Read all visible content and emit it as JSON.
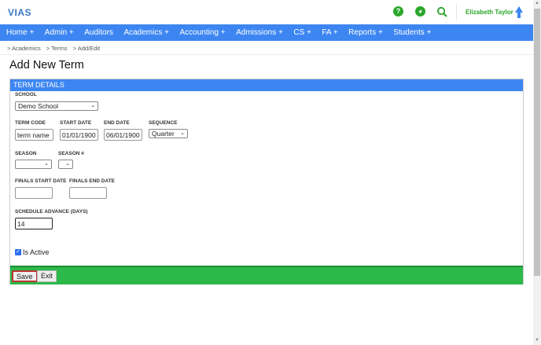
{
  "header": {
    "logo": "VIAS",
    "user_name": "Elizabeth Taylor",
    "icons": [
      "help-icon",
      "globe-icon",
      "search-icon",
      "arrow-up-icon"
    ]
  },
  "nav": [
    "Home +",
    "Admin +",
    "Auditors",
    "Academics +",
    "Accounting +",
    "Admissions +",
    "CS +",
    "FA +",
    "Reports +",
    "Students +"
  ],
  "breadcrumb": [
    "> Academics",
    "> Terms",
    "> Add/Edit"
  ],
  "page_title": "Add New Term",
  "panel": {
    "title": "TERM DETAILS",
    "school_label": "SCHOOL",
    "school_value": "Demo School",
    "term_code_label": "TERM CODE",
    "term_code_value": "term name",
    "start_date_label": "START DATE",
    "start_date_value": "01/01/1900",
    "end_date_label": "END DATE",
    "end_date_value": "06/01/1900",
    "sequence_label": "SEQUENCE",
    "sequence_value": "Quarter",
    "season_label": "SEASON",
    "season_num_label": "SEASON #",
    "finals_start_label": "FINALS START DATE",
    "finals_end_label": "FINALS END DATE",
    "schedule_label": "SCHEDULE ADVANCE (DAYS)",
    "schedule_value": "14",
    "is_active_label": "Is Active",
    "is_active": true
  },
  "buttons": {
    "save": "Save",
    "exit": "Exit"
  },
  "colors": {
    "nav": "#3d86f2",
    "footer": "#2db84a",
    "accent_green": "#2aa62a"
  }
}
